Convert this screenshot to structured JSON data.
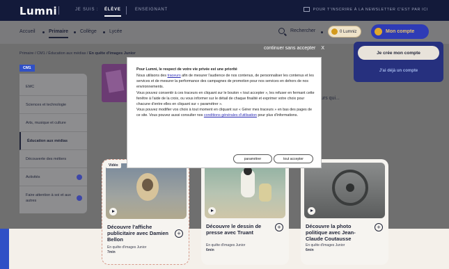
{
  "topbar": {
    "logo": "Lumni",
    "nav": [
      {
        "label": "JE SUIS :",
        "active": false
      },
      {
        "label": "ÉLÈVE",
        "active": true
      },
      {
        "label": "ENSEIGNANT",
        "active": false
      }
    ],
    "newsletter": "POUR T'INSCRIRE À LA NEWSLETTER C'EST PAR ICI"
  },
  "nav2": {
    "items": [
      "Accueil",
      "Primaire",
      "Collège",
      "Lycée"
    ],
    "active": "Primaire",
    "search_label": "Rechercher",
    "lumniz_label": "0 Lumniz",
    "account_label": "Mon compte"
  },
  "account_popup": {
    "create_label": "Je crée mon compte",
    "have_label": "J'ai déjà un compte"
  },
  "breadcrumb": {
    "path": "Primaire / CM1 / Éducation aux médias / ",
    "current": "En quête d'images Junior"
  },
  "continue_label": "continuer sans accepter",
  "continue_close": "X",
  "sidebar": {
    "tag": "CM1",
    "items": [
      {
        "label": "EMC"
      },
      {
        "label": "Sciences et technologie"
      },
      {
        "label": "Arts, musique et culture"
      },
      {
        "label": "Éducation aux médias",
        "active": true
      },
      {
        "label": "Découverte des métiers"
      },
      {
        "label": "Activités",
        "badge": true
      },
      {
        "label": "Faire attention à soi et aux autres",
        "badge": true
      }
    ]
  },
  "hero": {
    "partial_text": "urs qui..."
  },
  "cards": [
    {
      "tag": "Vidéo",
      "title": "Découvre l'affiche publicitaire avec Damien Bellon",
      "series": "En quête d'images Junior",
      "duration": "7min"
    },
    {
      "title": "Découvre le dessin de presse avec Truant",
      "series": "En quête d'images Junior",
      "duration": "6min"
    },
    {
      "title": "Découvre la photo politique avec Jean-Claude Coutausse",
      "series": "En quête d'images Junior",
      "duration": "6min"
    }
  ],
  "cookie_modal": {
    "title": "Pour Lumni, le respect de votre vie privée est une priorité",
    "p1_a": "Nous utilisons des ",
    "p1_link": "traceurs",
    "p1_b": " afin de mesurer l'audience de nos contenus, de personnaliser les contenus et les services et de mesurer la performance des campagnes de promotion pour nos services en dehors de nos environnements.",
    "p2": "Vous pouvez consentir à ces traceurs en cliquant sur le bouton « tout accepter », les refuser en fermant cette fenêtre à l'aide de la croix, ou vous informer sur le détail de chaque finalité et exprimer votre choix pour chacune d'entre elles en cliquant sur « paramétrer ».",
    "p3_a": "Vous pouvez modifier vos choix à tout moment en cliquant sur « Gérer mes traceurs » en bas des pages de ce site. Vous pouvez aussi consulter nos ",
    "p3_link": "conditions générales d'utilisation",
    "p3_b": " pour plus d'informations.",
    "settings_label": "paramétrer",
    "accept_label": "tout accepter"
  }
}
